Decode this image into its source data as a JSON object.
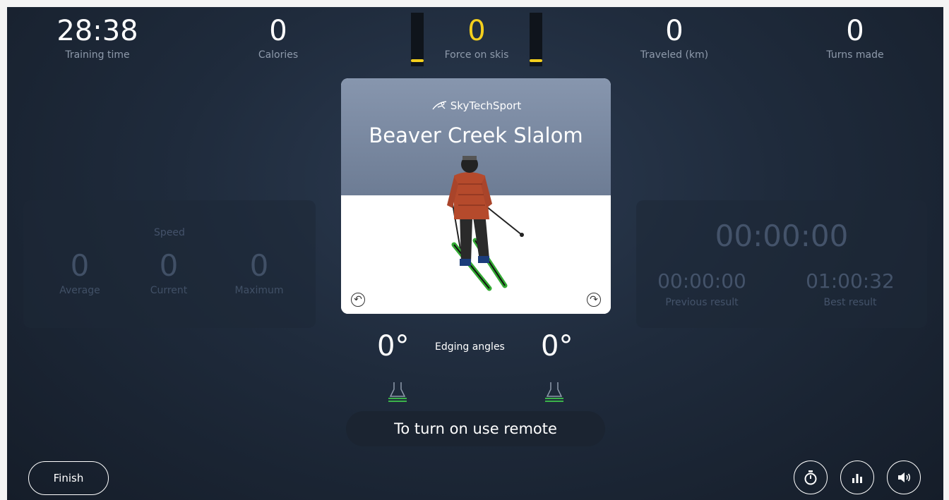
{
  "stats": {
    "training_time": {
      "value": "28:38",
      "label": "Training time"
    },
    "calories": {
      "value": "0",
      "label": "Calories"
    },
    "force": {
      "value": "0",
      "label": "Force on skis"
    },
    "traveled": {
      "value": "0",
      "label": "Traveled (km)"
    },
    "turns": {
      "value": "0",
      "label": "Turns made"
    }
  },
  "speed": {
    "title": "Speed",
    "average": {
      "value": "0",
      "label": "Average"
    },
    "current": {
      "value": "0",
      "label": "Current"
    },
    "maximum": {
      "value": "0",
      "label": "Maximum"
    }
  },
  "course": {
    "brand": "SkyTechSport",
    "name": "Beaver Creek Slalom"
  },
  "timer": {
    "main": "00:00:00",
    "previous": {
      "value": "00:00:00",
      "label": "Previous result"
    },
    "best": {
      "value": "01:00:32",
      "label": "Best result"
    }
  },
  "edging": {
    "label": "Edging angles",
    "left": "0°",
    "right": "0°"
  },
  "remote_message": "To turn on use remote",
  "buttons": {
    "finish": "Finish"
  },
  "colors": {
    "accent": "#f4cf1d",
    "background": "#1f2b3c",
    "boot_level": "#3bb34a"
  },
  "icons": [
    "stopwatch-icon",
    "bar-chart-icon",
    "speaker-icon",
    "rotate-left-icon",
    "rotate-right-icon",
    "skier-logo-icon",
    "ski-boot-icon"
  ]
}
